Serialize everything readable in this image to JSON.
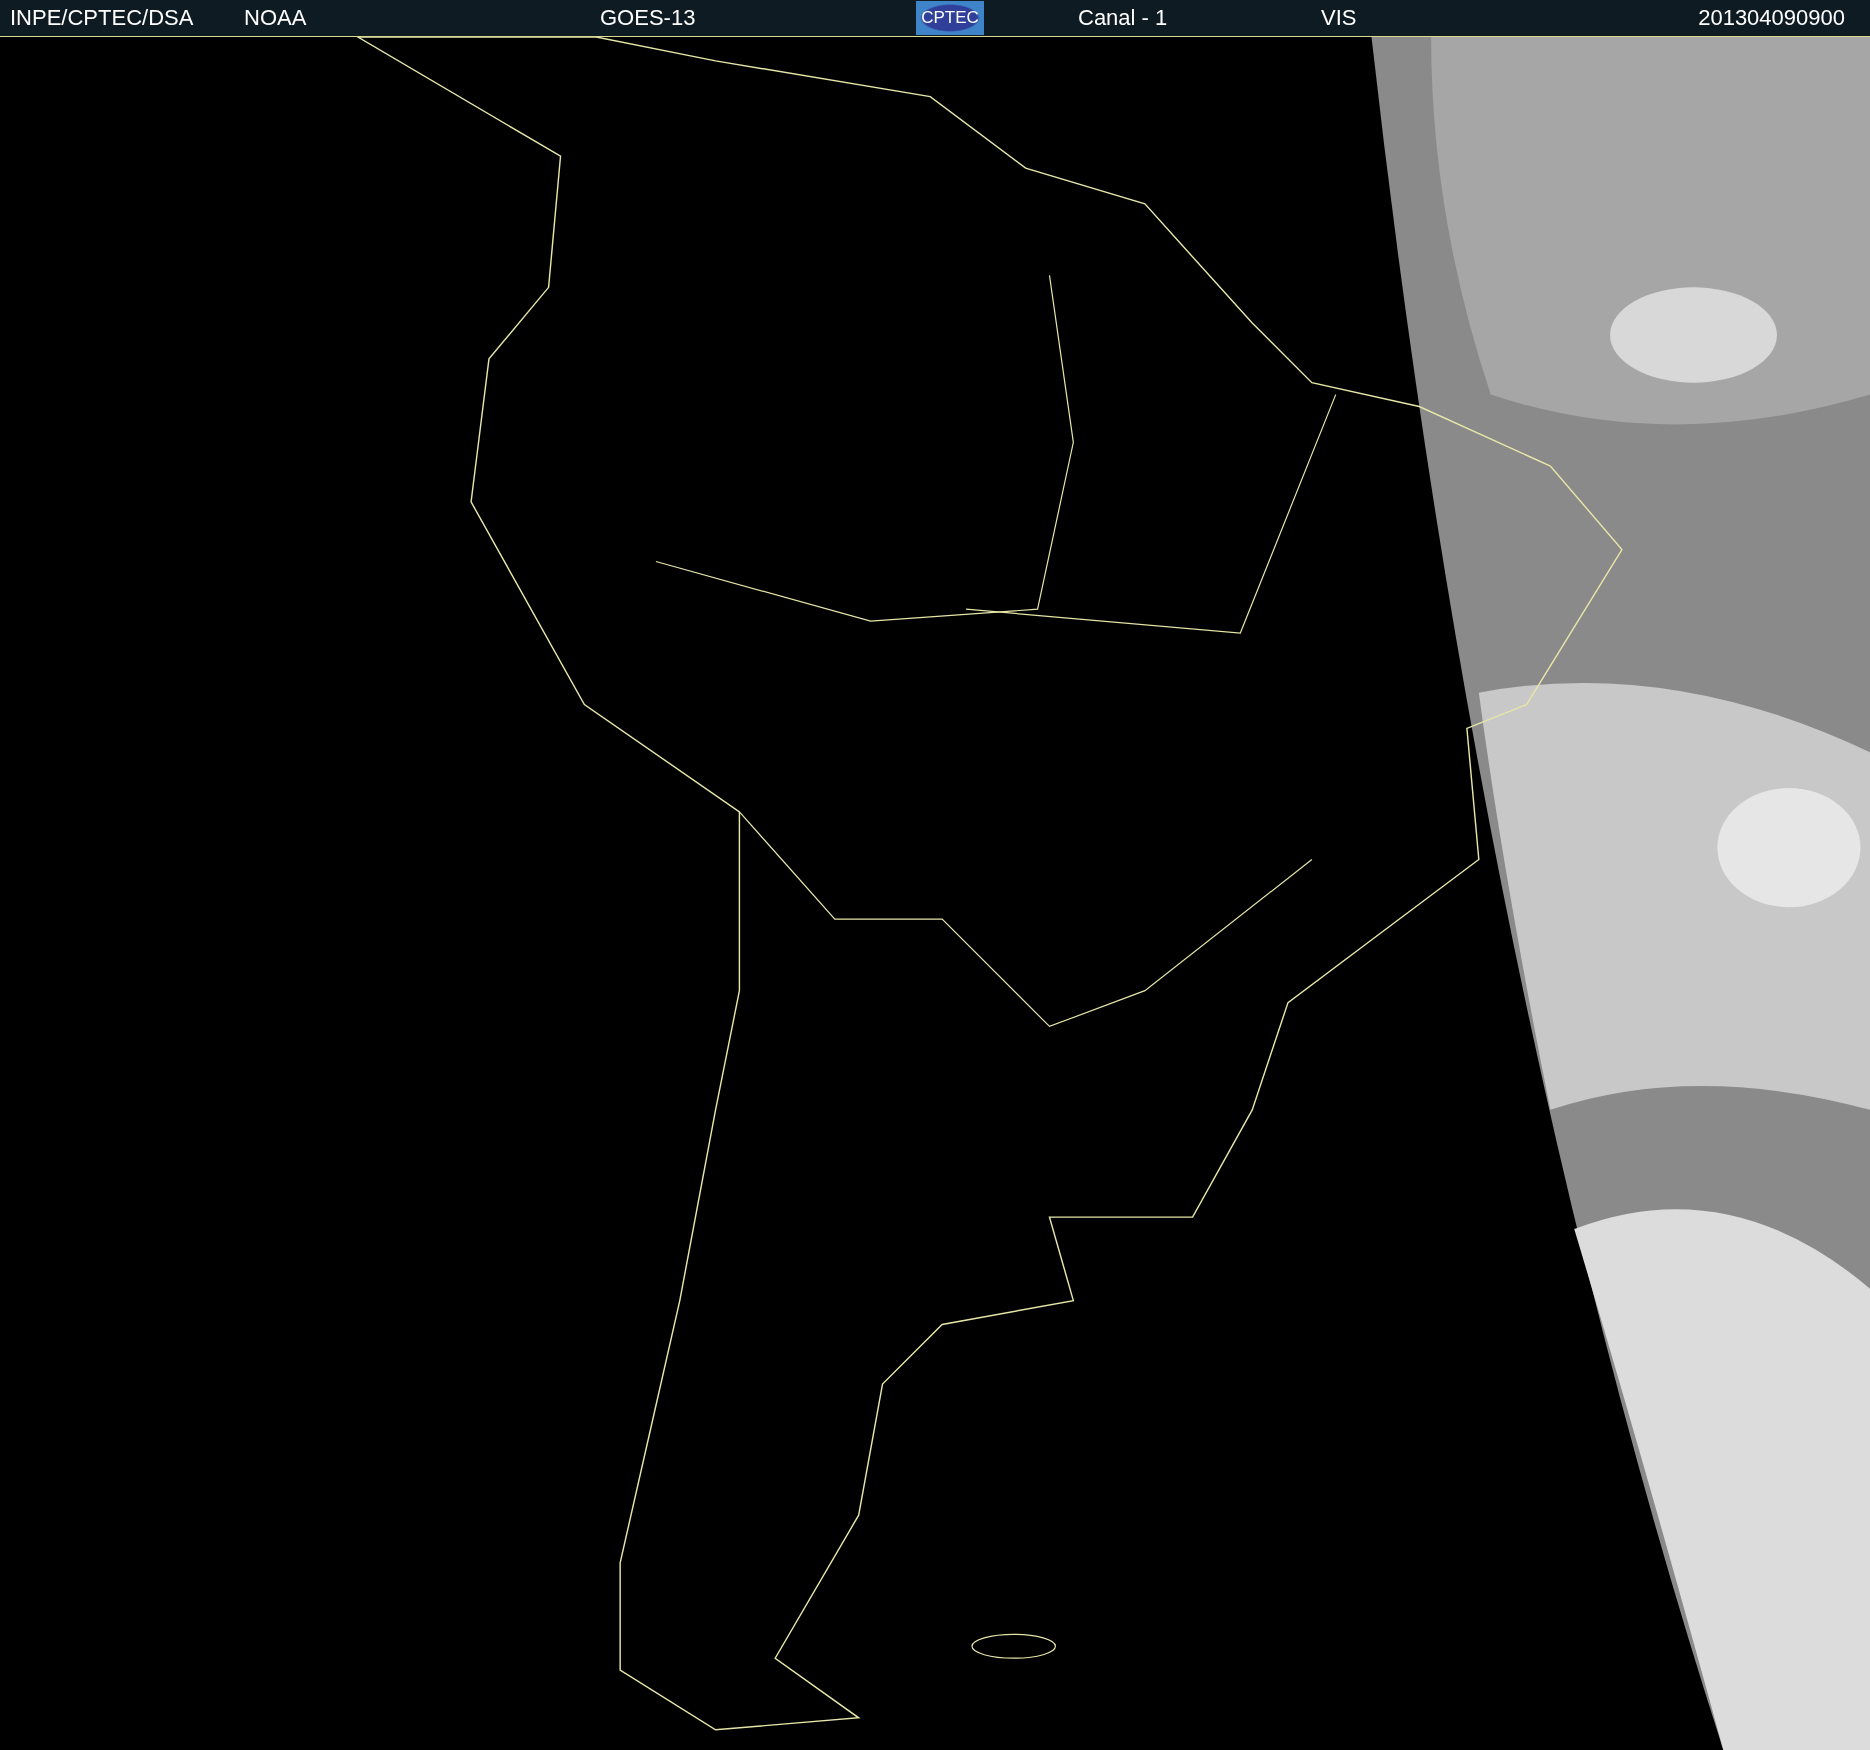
{
  "header": {
    "source": "INPE/CPTEC/DSA",
    "agency": "NOAA",
    "satellite": "GOES-13",
    "logo": "CPTEC",
    "channel": "Canal - 1",
    "band": "VIS",
    "timestamp": "201304090900"
  }
}
